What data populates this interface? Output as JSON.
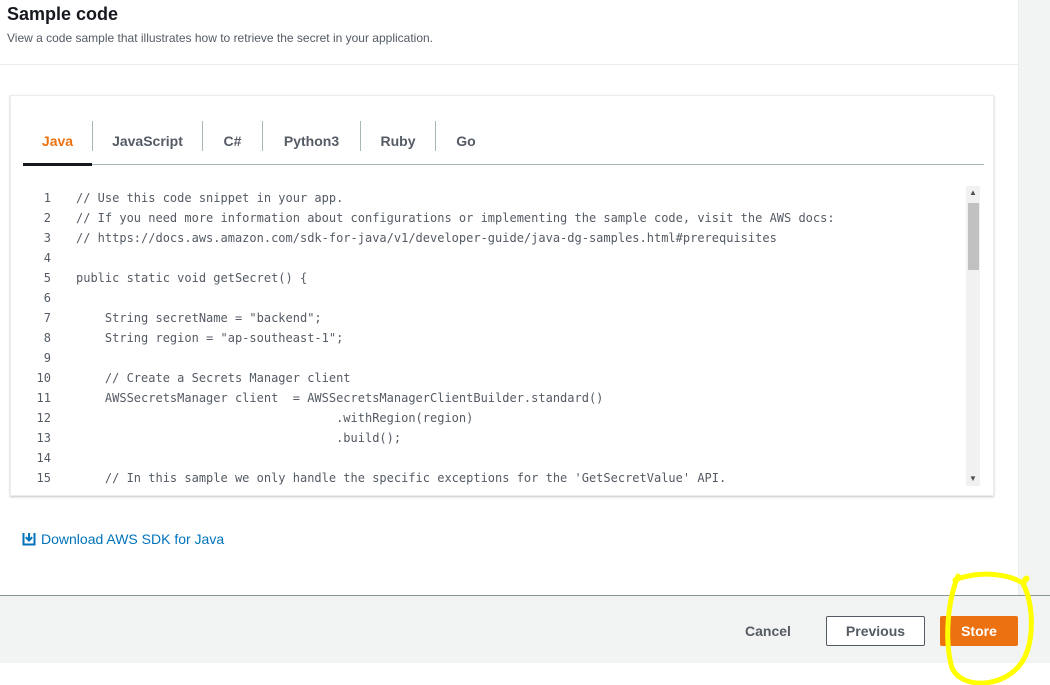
{
  "panel": {
    "title": "Sample code",
    "description": "View a code sample that illustrates how to retrieve the secret in your application."
  },
  "tabs": [
    {
      "label": "Java",
      "active": true
    },
    {
      "label": "JavaScript",
      "active": false
    },
    {
      "label": "C#",
      "active": false
    },
    {
      "label": "Python3",
      "active": false
    },
    {
      "label": "Ruby",
      "active": false
    },
    {
      "label": "Go",
      "active": false
    }
  ],
  "code": {
    "lines": [
      {
        "n": "1",
        "text": "// Use this code snippet in your app."
      },
      {
        "n": "2",
        "text": "// If you need more information about configurations or implementing the sample code, visit the AWS docs:"
      },
      {
        "n": "3",
        "text": "// https://docs.aws.amazon.com/sdk-for-java/v1/developer-guide/java-dg-samples.html#prerequisites"
      },
      {
        "n": "4",
        "text": ""
      },
      {
        "n": "5",
        "text": "public static void getSecret() {"
      },
      {
        "n": "6",
        "text": ""
      },
      {
        "n": "7",
        "text": "    String secretName = \"backend\";"
      },
      {
        "n": "8",
        "text": "    String region = \"ap-southeast-1\";"
      },
      {
        "n": "9",
        "text": ""
      },
      {
        "n": "10",
        "text": "    // Create a Secrets Manager client"
      },
      {
        "n": "11",
        "text": "    AWSSecretsManager client  = AWSSecretsManagerClientBuilder.standard()"
      },
      {
        "n": "12",
        "text": "                                    .withRegion(region)"
      },
      {
        "n": "13",
        "text": "                                    .build();"
      },
      {
        "n": "14",
        "text": ""
      },
      {
        "n": "15",
        "text": "    // In this sample we only handle the specific exceptions for the 'GetSecretValue' API."
      }
    ]
  },
  "download_link": {
    "label": "Download AWS SDK for Java"
  },
  "footer": {
    "cancel_label": "Cancel",
    "previous_label": "Previous",
    "store_label": "Store"
  },
  "colors": {
    "accent": "#ec7211",
    "link": "#0073bb",
    "highlight": "#ffff00"
  },
  "icons": {
    "download": "download-icon",
    "scroll_up": "scroll-up-arrow-icon",
    "scroll_down": "scroll-down-arrow-icon"
  }
}
